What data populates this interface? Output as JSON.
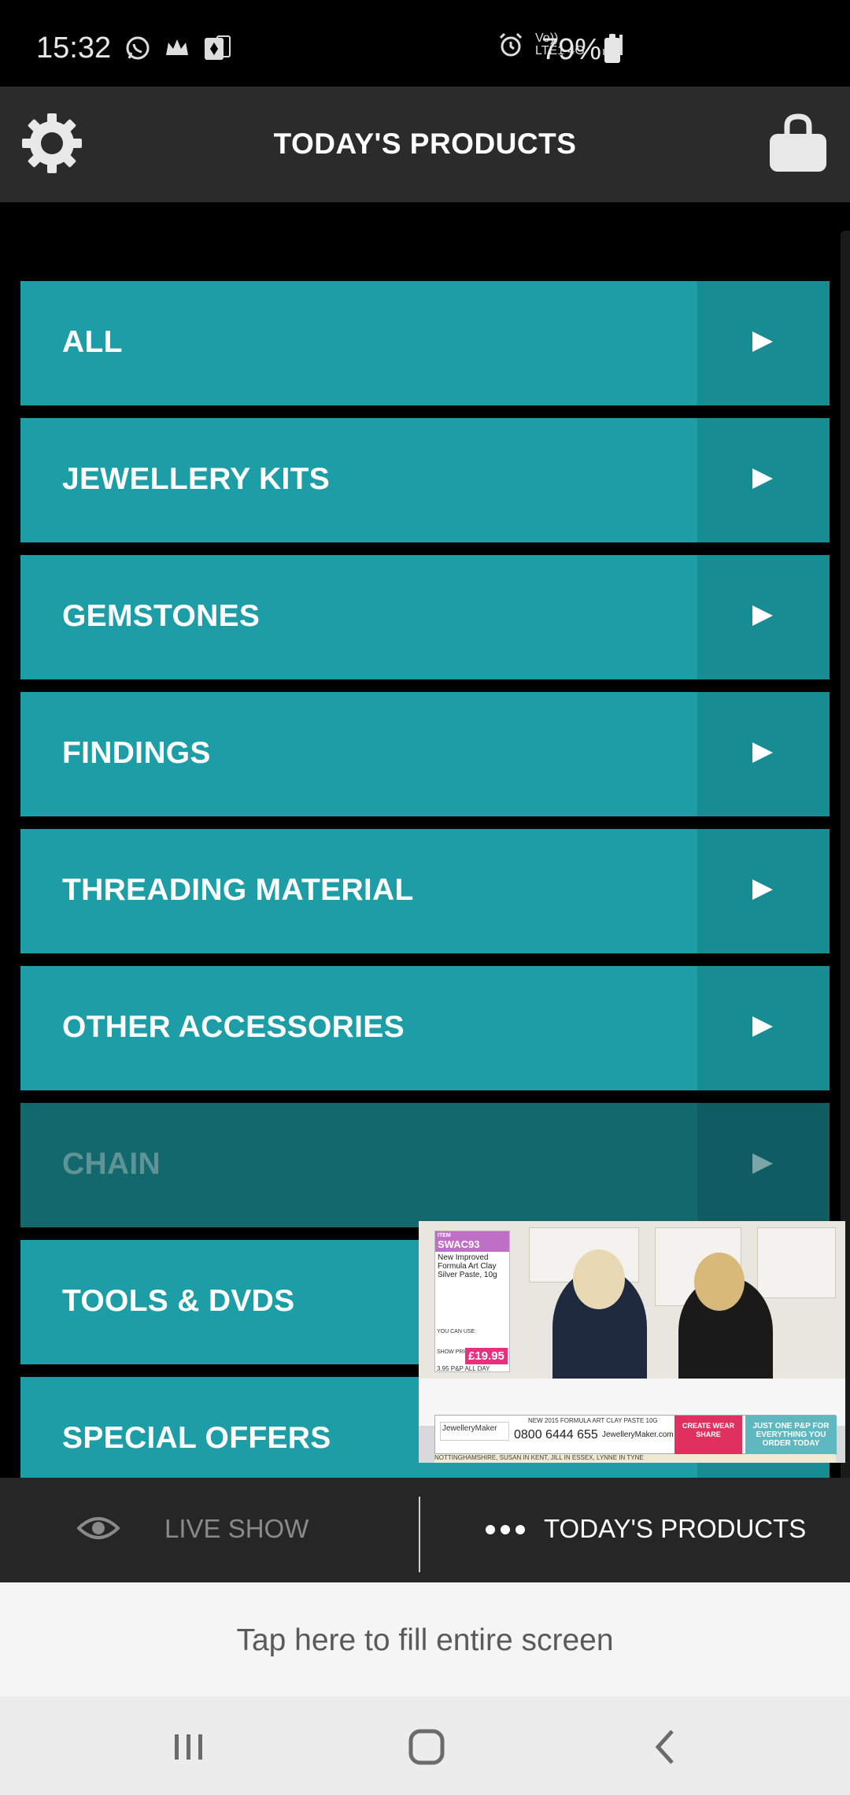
{
  "status_bar": {
    "time": "15:32",
    "network_label": "Vo)) LTE1 4G",
    "battery": "79%",
    "icons": [
      "whatsapp-icon",
      "crown-icon",
      "card-icon",
      "alarm-icon",
      "volte-icon",
      "4g-icon",
      "signal-icon",
      "battery-icon"
    ]
  },
  "header": {
    "title": "TODAY'S PRODUCTS",
    "settings_icon": "gear-icon",
    "basket_icon": "shopping-bag-icon"
  },
  "categories": [
    {
      "label": "ALL",
      "enabled": true
    },
    {
      "label": "JEWELLERY KITS",
      "enabled": true
    },
    {
      "label": "GEMSTONES",
      "enabled": true
    },
    {
      "label": "FINDINGS",
      "enabled": true
    },
    {
      "label": "THREADING MATERIAL",
      "enabled": true
    },
    {
      "label": "OTHER ACCESSORIES",
      "enabled": true
    },
    {
      "label": "CHAIN",
      "enabled": false
    },
    {
      "label": "TOOLS & DVDS",
      "enabled": true
    },
    {
      "label": "SPECIAL OFFERS",
      "enabled": true
    }
  ],
  "video": {
    "item_label": "ITEM",
    "item_code": "SWAC93",
    "item_desc": "New Improved Formula Art Clay Silver Paste, 10g",
    "pay_label": "YOU CAN USE:",
    "show_price_label": "SHOW PRICE",
    "price": "£19.95",
    "pp_note": "3.95 P&P ALL DAY",
    "brand": "JewelleryMaker",
    "headline": "NEW 2015 FORMULA ART CLAY PASTE 10G",
    "phone": "0800 6444 655",
    "site": "JewelleryMaker.com",
    "create_line": "CREATE WEAR SHARE",
    "one_pp_line": "JUST ONE P&P FOR EVERYTHING YOU ORDER TODAY",
    "ticker": "NOTTINGHAMSHIRE, SUSAN IN KENT, JILL IN ESSEX, LYNNE IN TYNE"
  },
  "bottom_tabs": {
    "live_label": "LIVE SHOW",
    "products_label": "TODAY'S PRODUCTS",
    "active": "products"
  },
  "fill_screen": {
    "text": "Tap here to fill entire screen"
  },
  "colors": {
    "accent": "#1d9ea6",
    "accent_dark": "#178c93",
    "disabled": "#12686d",
    "header_bg": "#2b2b2b"
  }
}
